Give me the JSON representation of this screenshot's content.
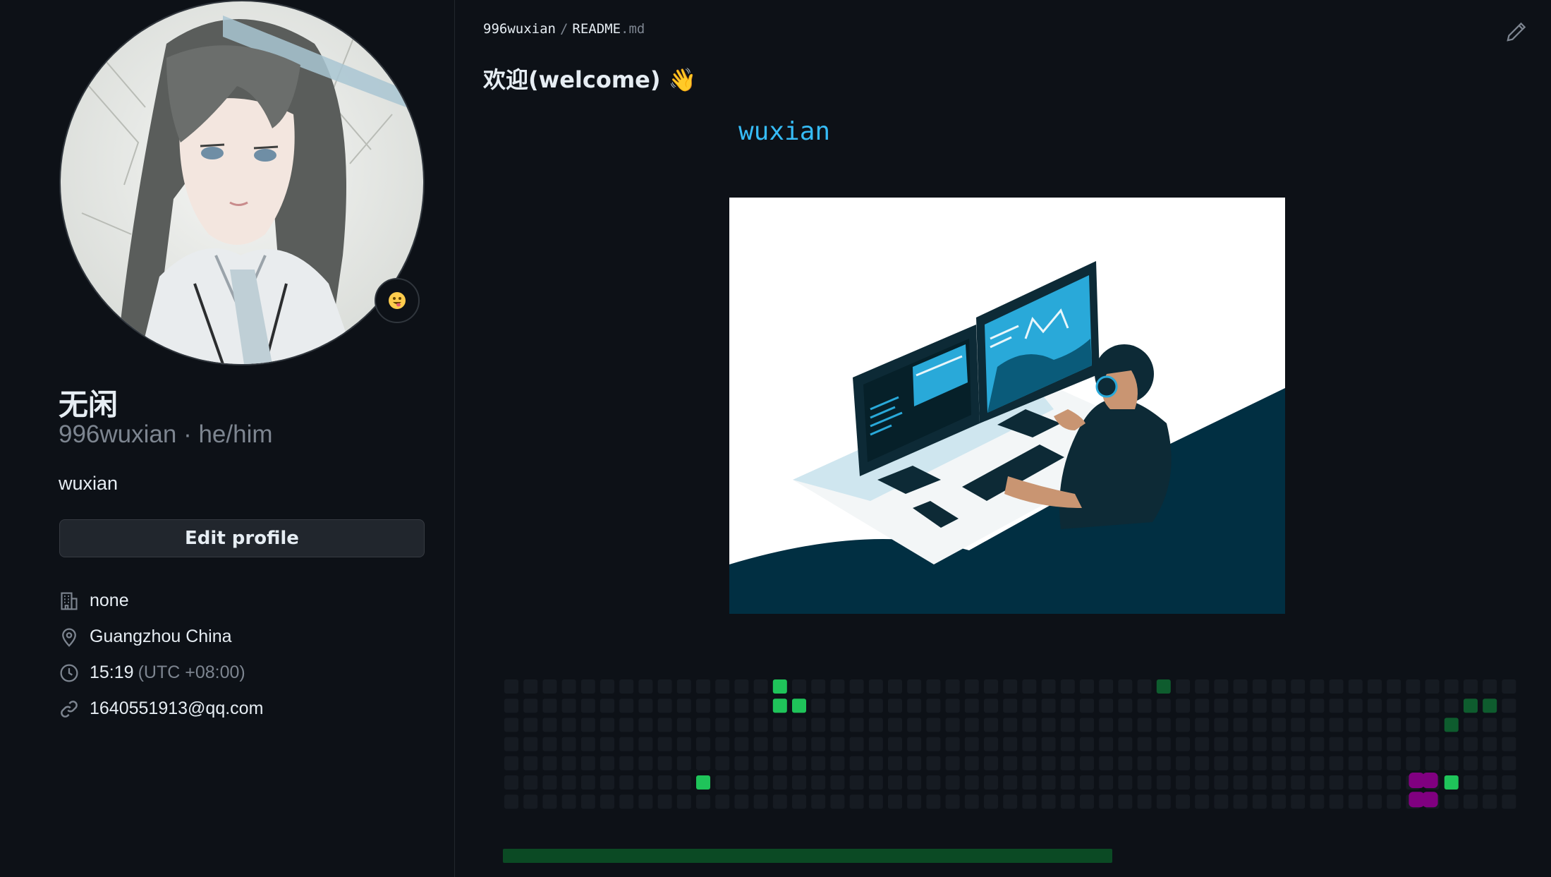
{
  "profile": {
    "display_name": "无闲",
    "username_line": "996wuxian · he/him",
    "bio": "wuxian",
    "edit_profile_label": "Edit profile",
    "status_emoji": "😛",
    "details": {
      "company": "none",
      "location": "Guangzhou China",
      "time": "15:19",
      "timezone": "(UTC +08:00)",
      "email": "1640551913@qq.com"
    },
    "icons": {
      "company": "building-icon",
      "location": "location-pin-icon",
      "time": "clock-icon",
      "email": "link-icon"
    }
  },
  "readme": {
    "breadcrumb": {
      "owner": "996wuxian",
      "separator": "/",
      "file_name": "README",
      "file_ext": ".md"
    },
    "title": "欢迎(welcome) 👋",
    "typing_text": "wuxian",
    "edit_icon": "pencil-icon"
  },
  "colors": {
    "background": "#0d1117",
    "typing_text": "#36bcf7",
    "contrib_empty": "#161b22",
    "contrib_green": "#1fc45a",
    "contrib_dark_green": "#0e5c2e",
    "snake": "#800080",
    "progress_bar": "#0b4a24"
  },
  "contributions": {
    "weeks": 53,
    "days": 7,
    "cells": [
      {
        "week": 14,
        "day": 0,
        "level": "green"
      },
      {
        "week": 14,
        "day": 1,
        "level": "green"
      },
      {
        "week": 15,
        "day": 1,
        "level": "green"
      },
      {
        "week": 10,
        "day": 5,
        "level": "green"
      },
      {
        "week": 34,
        "day": 0,
        "level": "dark"
      },
      {
        "week": 50,
        "day": 1,
        "level": "dark"
      },
      {
        "week": 51,
        "day": 1,
        "level": "dark"
      },
      {
        "week": 49,
        "day": 2,
        "level": "dark"
      },
      {
        "week": 49,
        "day": 5,
        "level": "green"
      }
    ],
    "snake": [
      {
        "week": 47,
        "day": 5
      },
      {
        "week": 48,
        "day": 5
      },
      {
        "week": 47,
        "day": 6
      },
      {
        "week": 48,
        "day": 6
      }
    ]
  }
}
